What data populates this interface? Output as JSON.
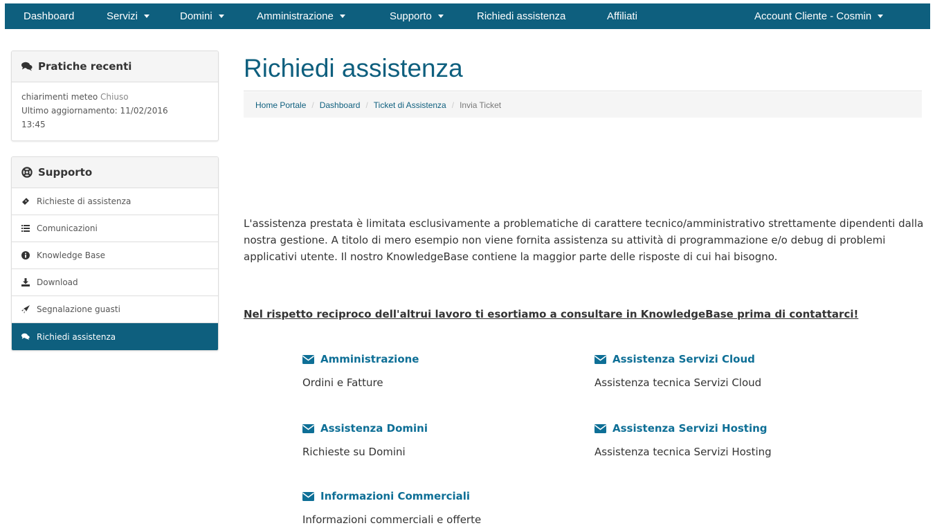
{
  "nav": {
    "dashboard": "Dashboard",
    "servizi": "Servizi",
    "domini": "Domini",
    "amministrazione": "Amministrazione",
    "supporto": "Supporto",
    "richiedi": "Richiedi assistenza",
    "affiliati": "Affiliati",
    "account": "Account Cliente - Cosmin"
  },
  "colors": {
    "brand": "#0e5f7e",
    "link": "#0e6f96",
    "panel_bg": "#f5f5f5"
  },
  "sidebar": {
    "recent": {
      "title": "Pratiche recenti",
      "icon": "comments-icon",
      "ticket_subject": "chiarimenti meteo",
      "ticket_status": "Chiuso",
      "updated_line": "Ultimo aggiornamento: 11/02/2016",
      "updated_time": "13:45"
    },
    "support": {
      "title": "Supporto",
      "icon": "life-ring-icon",
      "items": [
        {
          "label": "Richieste di assistenza",
          "icon": "ticket-icon"
        },
        {
          "label": "Comunicazioni",
          "icon": "list-icon"
        },
        {
          "label": "Knowledge Base",
          "icon": "info-circle-icon"
        },
        {
          "label": "Download",
          "icon": "download-icon"
        },
        {
          "label": "Segnalazione guasti",
          "icon": "rocket-icon"
        },
        {
          "label": "Richiedi assistenza",
          "icon": "comments-icon",
          "active": true
        }
      ]
    }
  },
  "page": {
    "title": "Richiedi assistenza",
    "breadcrumb": [
      "Home Portale",
      "Dashboard",
      "Ticket di Assistenza",
      "Invia Ticket"
    ],
    "intro": "L'assistenza prestata è limitata esclusivamente a problematiche di carattere tecnico/amministrativo strettamente dipendenti dalla nostra gestione. A titolo di mero esempio non viene fornita assistenza su attività di programmazione e/o debug di problemi applicativi utente. Il nostro KnowledgeBase contiene la maggior parte delle risposte di cui hai bisogno.",
    "notice": "Nel rispetto reciproco dell'altrui lavoro ti esortiamo a consultare in KnowledgeBase prima di contattarci!"
  },
  "departments": [
    {
      "name": "Amministrazione",
      "description": "Ordini e Fatture",
      "icon": "envelope-icon"
    },
    {
      "name": "Assistenza Servizi Cloud",
      "description": "Assistenza tecnica Servizi Cloud",
      "icon": "envelope-icon"
    },
    {
      "name": "Assistenza Domini",
      "description": "Richieste su Domini",
      "icon": "envelope-icon"
    },
    {
      "name": "Assistenza Servizi Hosting",
      "description": "Assistenza tecnica Servizi Hosting",
      "icon": "envelope-icon"
    },
    {
      "name": "Informazioni Commerciali",
      "description": "Informazioni commerciali e offerte",
      "icon": "envelope-icon"
    }
  ]
}
